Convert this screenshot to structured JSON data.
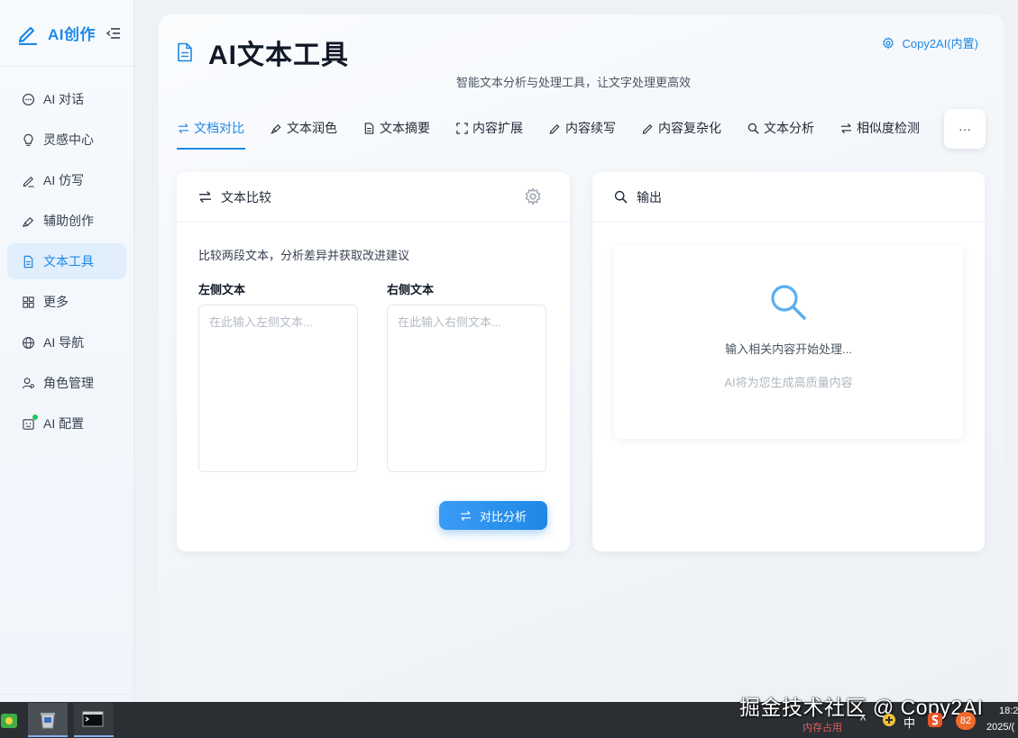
{
  "app": {
    "brand": "AI创作"
  },
  "sidebar": {
    "items": [
      {
        "label": "AI 对话",
        "icon": "chat-bubble-icon",
        "active": false
      },
      {
        "label": "灵感中心",
        "icon": "lightbulb-icon",
        "active": false
      },
      {
        "label": "AI 仿写",
        "icon": "pen-icon",
        "active": false
      },
      {
        "label": "辅助创作",
        "icon": "highlighter-icon",
        "active": false
      },
      {
        "label": "文本工具",
        "icon": "document-icon",
        "active": true
      },
      {
        "label": "更多",
        "icon": "grid-icon",
        "active": false
      },
      {
        "label": "AI 导航",
        "icon": "globe-icon",
        "active": false
      },
      {
        "label": "角色管理",
        "icon": "user-settings-icon",
        "active": false
      },
      {
        "label": "AI 配置",
        "icon": "robot-icon",
        "active": false
      }
    ]
  },
  "header": {
    "title": "AI文本工具",
    "subtitle": "智能文本分析与处理工具，让文字处理更高效",
    "model_label": "Copy2AI(内置)"
  },
  "tabs": [
    {
      "label": "文档对比",
      "icon": "swap-icon",
      "active": true
    },
    {
      "label": "文本润色",
      "icon": "brush-icon",
      "active": false
    },
    {
      "label": "文本摘要",
      "icon": "document-icon",
      "active": false
    },
    {
      "label": "内容扩展",
      "icon": "expand-icon",
      "active": false
    },
    {
      "label": "内容续写",
      "icon": "pen-icon",
      "active": false
    },
    {
      "label": "内容复杂化",
      "icon": "pen-icon",
      "active": false
    },
    {
      "label": "文本分析",
      "icon": "search-icon",
      "active": false
    },
    {
      "label": "相似度检测",
      "icon": "swap-icon",
      "active": false
    }
  ],
  "more_label": "···",
  "compare_card": {
    "title": "文本比较",
    "description": "比较两段文本，分析差异并获取改进建议",
    "left_label": "左侧文本",
    "left_placeholder": "在此输入左侧文本...",
    "left_value": "",
    "right_label": "右侧文本",
    "right_placeholder": "在此输入右侧文本...",
    "right_value": "",
    "button_label": "对比分析"
  },
  "output_card": {
    "title": "输出",
    "empty_title": "输入相关内容开始处理...",
    "empty_subtitle": "AI将为您生成高质量内容"
  },
  "taskbar": {
    "watermark": "掘金技术社区 @ Copy2AI",
    "memory_label": "内存占用",
    "ime_label": "中",
    "badge_count": "82",
    "time": "18:2",
    "date": "2025/("
  },
  "colors": {
    "accent": "#1e88e5",
    "active_bg": "#e1eefb",
    "status_dot": "#22c55e"
  }
}
